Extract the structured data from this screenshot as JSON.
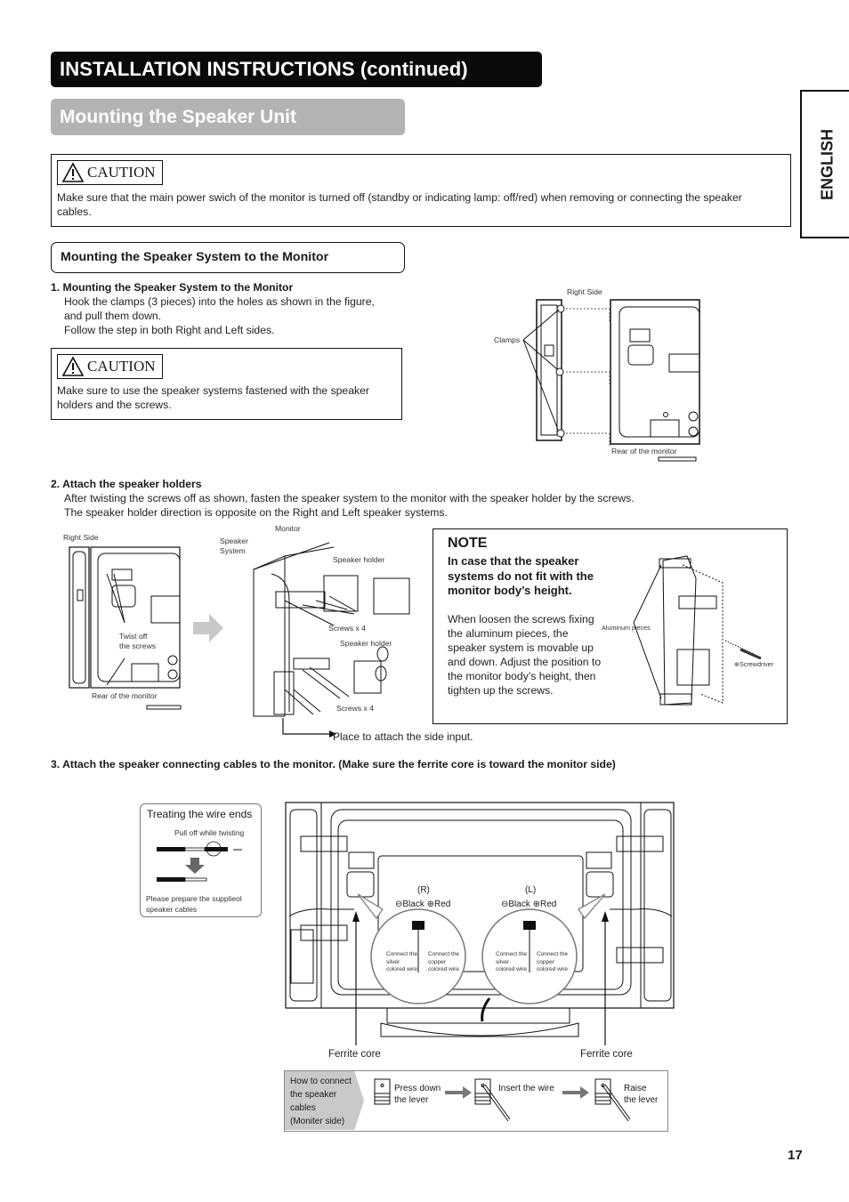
{
  "header": {
    "title": "INSTALLATION INSTRUCTIONS (continued)",
    "subtitle": "Mounting the Speaker Unit",
    "language_tab": "ENGLISH"
  },
  "caution_top": {
    "label": "CAUTION",
    "icon": "warning-triangle-icon",
    "text": "Make sure that the main power swich of the monitor is turned off (standby or indicating lamp: off/red) when removing or connecting the speaker cables."
  },
  "section": {
    "title": "Mounting the Speaker System to the Monitor"
  },
  "step1": {
    "title": "1. Mounting the Speaker System to the Monitor",
    "lines": [
      "Hook the clamps (3 pieces) into the holes as shown in the figure,",
      "and pull them down.",
      "Follow the step in both Right and Left sides."
    ],
    "caution": {
      "label": "CAUTION",
      "text": "Make sure to use the speaker systems fastened with the speaker holders and the screws."
    },
    "figure": {
      "right_side": "Right Side",
      "clamps": "Clamps",
      "rear": "Rear of the monitor"
    }
  },
  "step2": {
    "title": "2. Attach the speaker holders",
    "lines": [
      "After twisting the screws off as shown, fasten the speaker system to the monitor with the speaker holder by the screws.",
      "The speaker holder direction is opposite on the Right and Left speaker systems."
    ],
    "figure_left": {
      "right_side": "Right Side",
      "twist_off": "Twist off",
      "the_screws": "the screws",
      "rear": "Rear of the monitor"
    },
    "figure_right": {
      "monitor": "Monitor",
      "speaker": "Speaker",
      "system": "System",
      "speaker_holder_top": "Speaker holder",
      "screws_top": "Screws x 4",
      "speaker_holder_bottom": "Speaker holder",
      "screws_bottom": "Screws x 4",
      "side_input": "Place to attach the side input."
    },
    "note": {
      "title": "NOTE",
      "heading": "In case that the speaker systems do not fit with the monitor body’s height.",
      "text": "When loosen the screws fixing the aluminum pieces, the speaker system is movable up and down. Adjust the position to the monitor body’s height, then tighten up the screws.",
      "aluminum": "Aluminum pieces",
      "screwdriver": "⊕Screwdriver"
    }
  },
  "step3": {
    "title": "3. Attach the speaker connecting cables to the monitor. (Make sure the ferrite core is toward the monitor side)",
    "wire_ends": {
      "title": "Treating the wire ends",
      "pull": "Pull off while twisting",
      "prepare": "Please prepare the supplieol speaker cables"
    },
    "callouts": [
      {
        "side": "(R)",
        "polarity": "⊖Black ⊕Red",
        "silver": [
          "Connect the",
          "silver",
          "colored wire"
        ],
        "copper": [
          "Connect the",
          "copper",
          "colored wire"
        ]
      },
      {
        "side": "(L)",
        "polarity": "⊖Black ⊕Red",
        "silver": [
          "Connect the",
          "silver",
          "colored wire"
        ],
        "copper": [
          "Connect the",
          "copper",
          "colored wire"
        ]
      }
    ],
    "ferrite_left": "Ferrite core",
    "ferrite_right": "Ferrite core",
    "howto": {
      "label_lines": [
        "How to connect",
        "the speaker",
        "cables",
        "(Moniter side)"
      ],
      "step1": [
        "Press down",
        "the lever"
      ],
      "step2": "Insert the wire",
      "step3": [
        "Raise",
        "the lever"
      ]
    }
  },
  "footer": {
    "page_number": "17"
  }
}
